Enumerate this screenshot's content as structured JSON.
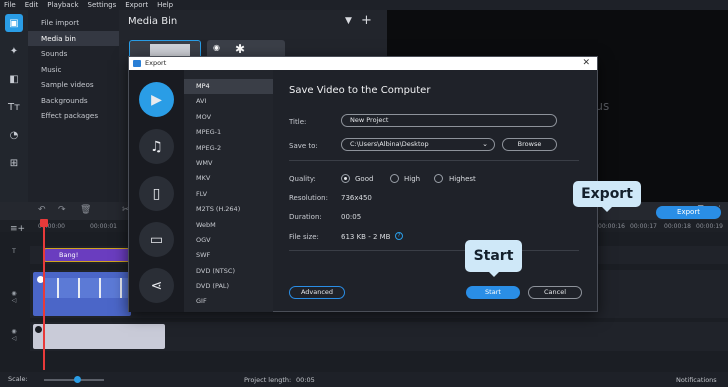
{
  "menu": [
    "File",
    "Edit",
    "Playback",
    "Settings",
    "Export",
    "Help"
  ],
  "sidebar": {
    "items": [
      {
        "label": "File import",
        "active": false
      },
      {
        "label": "Media bin",
        "active": true
      },
      {
        "label": "Sounds",
        "active": false
      },
      {
        "label": "Music",
        "active": false
      },
      {
        "label": "Sample videos",
        "active": false
      },
      {
        "label": "Backgrounds",
        "active": false
      },
      {
        "label": "Effect packages",
        "active": false
      }
    ]
  },
  "mediabin": {
    "title": "Media Bin"
  },
  "player": {
    "partial_text": "lus"
  },
  "timeline": {
    "ruler": [
      "00:00:00",
      "00:00:01",
      "00:00:16",
      "00:00:17",
      "00:00:18",
      "00:00:19"
    ],
    "title_clip": "Bang!",
    "export_label": "Export"
  },
  "status": {
    "project_length_label": "Project length:",
    "project_length": "00:05",
    "notifications": "Notifications"
  },
  "dialog": {
    "window_title": "Export",
    "heading": "Save Video to the Computer",
    "formats": [
      "MP4",
      "AVI",
      "MOV",
      "MPEG-1",
      "MPEG-2",
      "WMV",
      "MKV",
      "FLV",
      "M2TS (H.264)",
      "WebM",
      "OGV",
      "SWF",
      "DVD (NTSC)",
      "DVD (PAL)",
      "GIF"
    ],
    "selected_format": "MP4",
    "title_label": "Title:",
    "title_value": "New Project",
    "save_to_label": "Save to:",
    "save_to_value": "C:\\Users\\Albina\\Desktop",
    "browse": "Browse",
    "quality_label": "Quality:",
    "quality_options": [
      "Good",
      "High",
      "Highest"
    ],
    "quality_selected": "Good",
    "resolution_label": "Resolution:",
    "resolution_value": "736x450",
    "duration_label": "Duration:",
    "duration_value": "00:05",
    "filesize_label": "File size:",
    "filesize_value": "613 KB - 2 MB",
    "advanced": "Advanced",
    "start": "Start",
    "cancel": "Cancel"
  },
  "callouts": {
    "export": "Export",
    "start": "Start"
  },
  "colors": {
    "accent": "#2a8ee6",
    "callout": "#cfe8f8",
    "title_clip": "#6a3dbf",
    "video_clip": "#4b66c8",
    "playhead": "#e83a3a"
  }
}
